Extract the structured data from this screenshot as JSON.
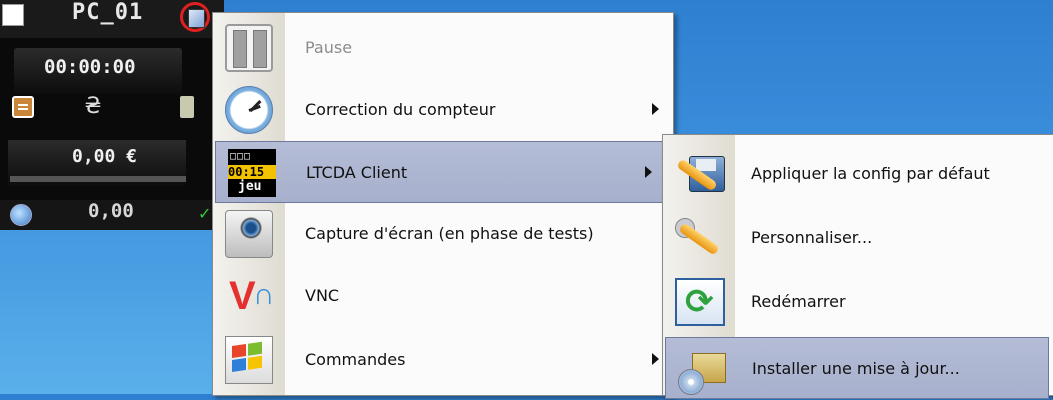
{
  "widget": {
    "name": "PC_01",
    "timer": "00:00:00",
    "amount": "0,00 €",
    "balance": "0,00"
  },
  "menu": {
    "items": [
      {
        "label": "Pause",
        "icon": "pause-icon",
        "enabled": false,
        "submenu": false
      },
      {
        "label": "Correction du compteur",
        "icon": "clock-icon",
        "enabled": true,
        "submenu": true
      },
      {
        "label": "LTCDA Client",
        "icon": "ltcda-client-icon",
        "enabled": true,
        "submenu": true,
        "highlighted": true
      },
      {
        "label": "Capture d'écran (en phase de tests)",
        "icon": "camera-icon",
        "enabled": true,
        "submenu": false
      },
      {
        "label": "VNC",
        "icon": "vnc-icon",
        "enabled": true,
        "submenu": false
      },
      {
        "label": "Commandes",
        "icon": "commands-icon",
        "enabled": true,
        "submenu": true
      }
    ],
    "ltcda_icon": {
      "top": "□□□",
      "mid": "00:15",
      "bot": "jeu"
    }
  },
  "submenu": {
    "items": [
      {
        "label": "Appliquer la config par défaut",
        "icon": "apply-config-icon"
      },
      {
        "label": "Personnaliser...",
        "icon": "wrench-icon"
      },
      {
        "label": "Redémarrer",
        "icon": "restart-icon"
      },
      {
        "label": "Installer une mise à jour...",
        "icon": "install-update-icon",
        "highlighted": true
      }
    ]
  },
  "colors": {
    "highlight": "#b4bcd6",
    "desktop": "#3b8fdc",
    "widget_bg": "#0a0a0a"
  }
}
